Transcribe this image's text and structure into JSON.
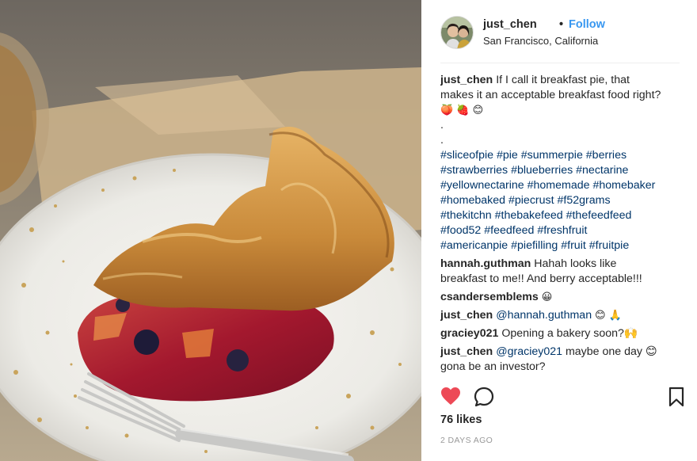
{
  "post": {
    "username": "just_chen",
    "separator": "•",
    "follow_label": "Follow",
    "location": "San Francisco, California",
    "photo_icon": "pie-photo",
    "caption": {
      "username": "just_chen",
      "line1": "If I call it breakfast pie, that",
      "line2": "makes it an acceptable breakfast food right?",
      "emojis": "🍑 🍓 😊",
      "dots": [
        ".",
        "."
      ],
      "hashtags": [
        [
          "#sliceofpie",
          "#pie",
          "#summerpie",
          "#berries"
        ],
        [
          "#strawberries",
          "#blueberries",
          "#nectarine"
        ],
        [
          "#yellownectarine",
          "#homemade",
          "#homebaker"
        ],
        [
          "#homebaked",
          "#piecrust",
          "#f52grams"
        ],
        [
          "#thekitchn",
          "#thebakefeed",
          "#thefeedfeed"
        ],
        [
          "#food52",
          "#feedfeed",
          "#freshfruit"
        ],
        [
          "#americanpie",
          "#piefilling",
          "#fruit",
          "#fruitpie"
        ]
      ]
    },
    "comments": [
      {
        "user": "hannah.guthman",
        "line1": "Hahah looks like",
        "line2": "breakfast to me!! And berry acceptable!!!"
      },
      {
        "user": "csandersemblems",
        "text": "😀"
      },
      {
        "user": "just_chen",
        "mention": "@hannah.guthman",
        "text": "😊 🙏"
      },
      {
        "user": "graciey021",
        "text": "Opening a bakery soon?🙌"
      },
      {
        "user": "just_chen",
        "mention": "@graciey021",
        "text": "maybe one day 😊",
        "line2": "gona be an investor?"
      }
    ],
    "likes": "76 likes",
    "time": "2 DAYS AGO",
    "colors": {
      "like": "#ed4956",
      "link": "#003569",
      "follow": "#3897f0"
    },
    "icons": {
      "like": "heart-icon",
      "comment": "comment-bubble-icon",
      "save": "bookmark-icon"
    }
  }
}
